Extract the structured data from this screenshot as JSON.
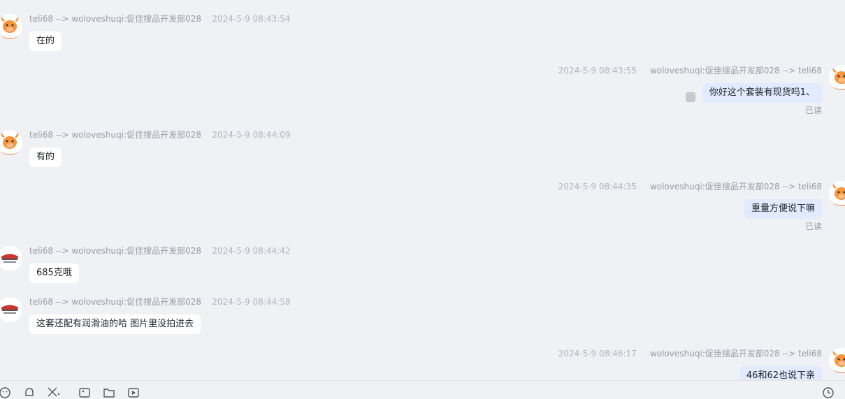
{
  "messages": [
    {
      "direction": "in",
      "avatar": "orange-bull",
      "sender": "teli68 --> woloveshuqi:促佳搜品开发部028",
      "time": "2024-5-9 08:43:54",
      "text": "在的",
      "status": ""
    },
    {
      "direction": "out",
      "avatar": "orange-bull",
      "sender": "woloveshuqi:促佳搜品开发部028 --> teli68",
      "time": "2024-5-9 08:43:55",
      "text": "你好这个套装有现货吗1、",
      "status": "已读"
    },
    {
      "direction": "in",
      "avatar": "orange-bull",
      "sender": "teli68 --> woloveshuqi:促佳搜品开发部028",
      "time": "2024-5-9 08:44:09",
      "text": "有的",
      "status": ""
    },
    {
      "direction": "out",
      "avatar": "orange-bull",
      "sender": "woloveshuqi:促佳搜品开发部028 --> teli68",
      "time": "2024-5-9 08:44:35",
      "text": "重量方便说下嘛",
      "status": "已读"
    },
    {
      "direction": "in",
      "avatar": "shop-logo",
      "sender": "teli68 --> woloveshuqi:促佳搜品开发部028",
      "time": "2024-5-9 08:44:42",
      "text": "685克哦",
      "status": ""
    },
    {
      "direction": "in",
      "avatar": "shop-logo",
      "sender": "teli68 --> woloveshuqi:促佳搜品开发部028",
      "time": "2024-5-9 08:44:58",
      "text": "这套还配有润滑油的哈 图片里没拍进去",
      "status": ""
    },
    {
      "direction": "out",
      "avatar": "orange-bull",
      "sender": "woloveshuqi:促佳搜品开发部028 --> teli68",
      "time": "2024-5-9 08:46:17",
      "text": "46和62也说下亲",
      "status": ""
    }
  ],
  "toolbar": {
    "icons": [
      "emoji-icon",
      "bell-icon",
      "scissors-icon",
      "image-icon",
      "folder-icon",
      "video-icon",
      "clock-icon"
    ]
  },
  "colors": {
    "background": "#f0f1f5",
    "incoming_bubble": "#ffffff",
    "outgoing_bubble": "#e1ebfd",
    "avatar_orange": "#f57b3b"
  }
}
